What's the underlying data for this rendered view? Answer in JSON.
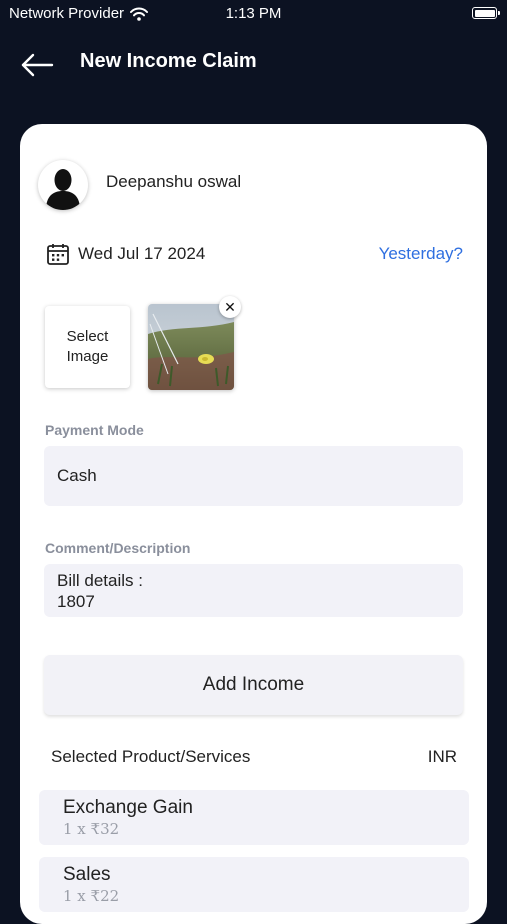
{
  "status_bar": {
    "carrier": "Network Provider",
    "time": "1:13 PM",
    "icons": [
      "wifi-icon",
      "battery-icon"
    ]
  },
  "header": {
    "back_icon": "back-arrow-icon",
    "title": "New Income Claim"
  },
  "user": {
    "name": "Deepanshu oswal",
    "avatar_icon": "user-silhouette-icon"
  },
  "date": {
    "icon": "calendar-icon",
    "value": "Wed Jul 17 2024",
    "yesterday_link": "Yesterday?"
  },
  "image_picker": {
    "select_label": "Select\nImage",
    "remove_icon": "close-icon"
  },
  "payment_mode": {
    "label": "Payment Mode",
    "value": "Cash"
  },
  "comment": {
    "label": "Comment/Description",
    "value": "Bill details :\n1807"
  },
  "add_income_label": "Add Income",
  "selected_section": {
    "title": "Selected Product/Services",
    "currency": "INR",
    "items": [
      {
        "name": "Exchange Gain",
        "qty": "1 x ₹32"
      },
      {
        "name": "Sales",
        "qty": "1 x ₹22"
      }
    ]
  },
  "colors": {
    "background": "#0c1222",
    "card": "#ffffff",
    "field": "#f2f2f8",
    "link": "#2f6fe0",
    "label": "#8a8f9c"
  }
}
